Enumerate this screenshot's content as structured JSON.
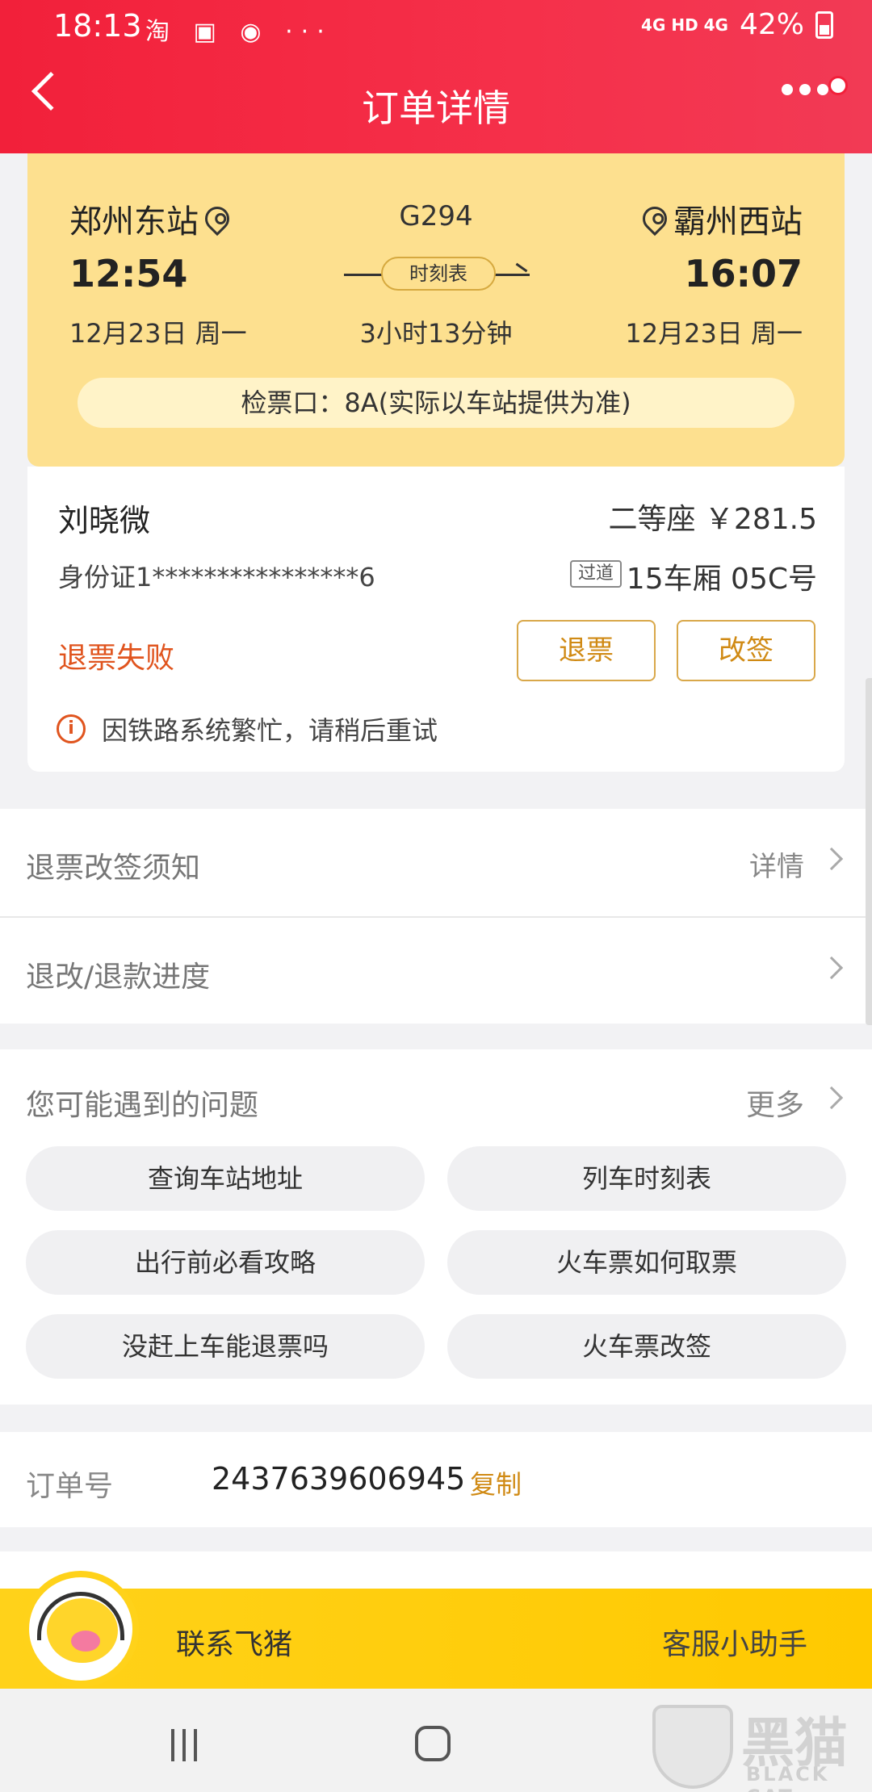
{
  "status": {
    "time": "18:13",
    "notif_icons": "淘 ▣ ◉ ···",
    "network": "4G HD 4G",
    "battery": "42%"
  },
  "header": {
    "title": "订单详情"
  },
  "trip": {
    "from_station": "郑州东站",
    "to_station": "霸州西站",
    "train_no": "G294",
    "depart_time": "12:54",
    "arrive_time": "16:07",
    "schedule_label": "时刻表",
    "depart_date": "12月23日 周一",
    "arrive_date": "12月23日 周一",
    "duration": "3小时13分钟",
    "gate": "检票口：8A(实际以车站提供为准)"
  },
  "passenger": {
    "name": "刘晓微",
    "seat_class_price": "二等座 ￥281.5",
    "id_number": "身份证1****************6",
    "seat_tag": "过道",
    "car_seat": "15车厢 05C号",
    "status": "退票失败",
    "refund_button": "退票",
    "change_button": "改签",
    "hint": "因铁路系统繁忙，请稍后重试"
  },
  "rows": {
    "notice_label": "退票改签须知",
    "notice_value": "详情",
    "progress_label": "退改/退款进度"
  },
  "faq": {
    "title": "您可能遇到的问题",
    "more": "更多",
    "items": [
      "查询车站地址",
      "列车时刻表",
      "出行前必看攻略",
      "火车票如何取票",
      "没赶上车能退票吗",
      "火车票改签"
    ]
  },
  "order": {
    "label": "订单号",
    "number": "2437639606945",
    "copy": "复制"
  },
  "service": {
    "contact": "联系飞猪",
    "assistant": "客服小助手"
  },
  "watermark": {
    "cn": "黑猫",
    "en": "BLACK CAT"
  }
}
